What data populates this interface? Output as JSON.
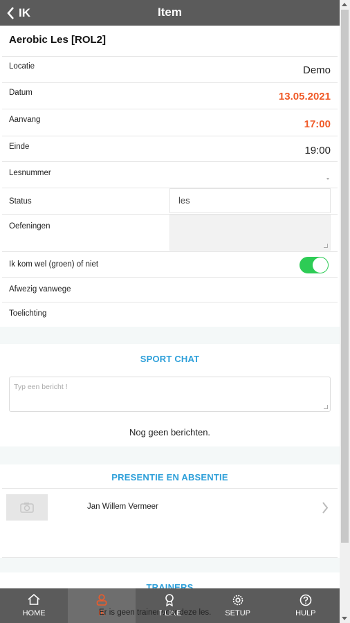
{
  "header": {
    "back_label": "IK",
    "title": "Item"
  },
  "item": {
    "title": "Aerobic Les [ROL2]"
  },
  "fields": {
    "locatie": {
      "label": "Locatie",
      "value": "Demo"
    },
    "datum": {
      "label": "Datum",
      "value": "13.05.2021"
    },
    "aanvang": {
      "label": "Aanvang",
      "value": "17:00"
    },
    "einde": {
      "label": "Einde",
      "value": "19:00"
    },
    "lesnummer": {
      "label": "Lesnummer"
    },
    "status": {
      "label": "Status",
      "value": "les"
    },
    "oefeningen": {
      "label": "Oefeningen"
    },
    "attendance": {
      "label": "Ik kom wel (groen) of niet",
      "on": true
    },
    "afwezig": {
      "label": "Afwezig vanwege"
    },
    "toelichting": {
      "label": "Toelichting"
    }
  },
  "chat": {
    "title": "SPORT CHAT",
    "placeholder": "Typ een bericht !",
    "empty": "Nog geen berichten."
  },
  "presence": {
    "title": "PRESENTIE EN ABSENTIE",
    "people": [
      {
        "name": "Jan Willem Vermeer"
      }
    ]
  },
  "trainers": {
    "title": "TRAINERS",
    "empty": "Er is geen trainer voor deze les."
  },
  "colors": {
    "accent": "#f05a28",
    "section": "#2d9fd9",
    "toggle": "#2dcc55",
    "bar": "#5b5b5b"
  },
  "nav": [
    {
      "label": "HOME",
      "icon": "home-icon"
    },
    {
      "label": "IK",
      "icon": "user-icon",
      "active": true
    },
    {
      "label": "T-LINE",
      "icon": "trophy-icon"
    },
    {
      "label": "SETUP",
      "icon": "gear-icon"
    },
    {
      "label": "HULP",
      "icon": "help-icon"
    }
  ]
}
